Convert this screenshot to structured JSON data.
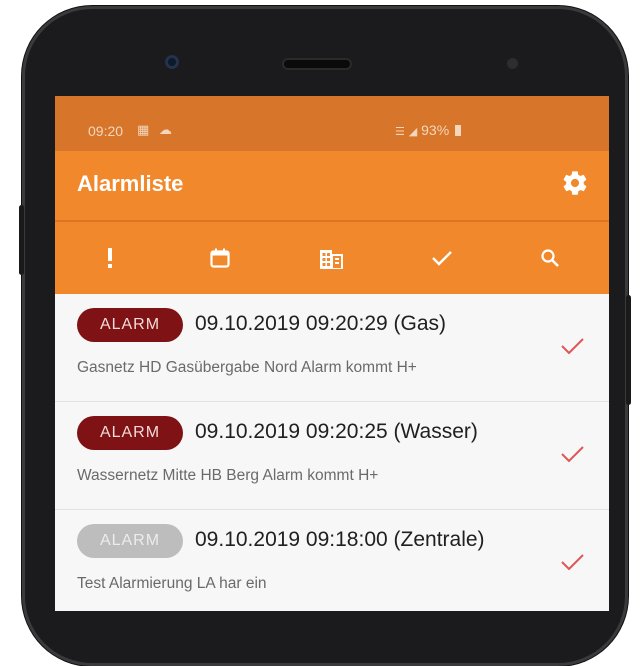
{
  "status_bar": {
    "time": "09:20",
    "left_icons": [
      "image-icon",
      "weather-icon"
    ],
    "right_text": "93%",
    "right_icons": [
      "wifi-icon",
      "signal-icon",
      "battery-icon"
    ]
  },
  "app_bar": {
    "title": "Alarmliste",
    "settings_icon": "gear-icon"
  },
  "tabs": [
    {
      "icon": "exclamation-icon"
    },
    {
      "icon": "calendar-icon"
    },
    {
      "icon": "building-icon"
    },
    {
      "icon": "check-icon"
    },
    {
      "icon": "search-icon"
    }
  ],
  "alarms": [
    {
      "badge": "ALARM",
      "active": true,
      "title": "09.10.2019 09:20:29 (Gas)",
      "description": "Gasnetz HD Gasübergabe Nord Alarm kommt  H+"
    },
    {
      "badge": "ALARM",
      "active": true,
      "title": "09.10.2019 09:20:25 (Wasser)",
      "description": "Wassernetz Mitte HB Berg Alarm kommt  H+"
    },
    {
      "badge": "ALARM",
      "active": false,
      "title": "09.10.2019 09:18:00 (Zentrale)",
      "description": "Test Alarmierung LA har ein"
    }
  ],
  "colors": {
    "status_bar": "#d7762a",
    "app_bar": "#f2882c",
    "badge_active": "#7e1214",
    "badge_inactive": "#bdbdbd",
    "check": "#e05555"
  }
}
